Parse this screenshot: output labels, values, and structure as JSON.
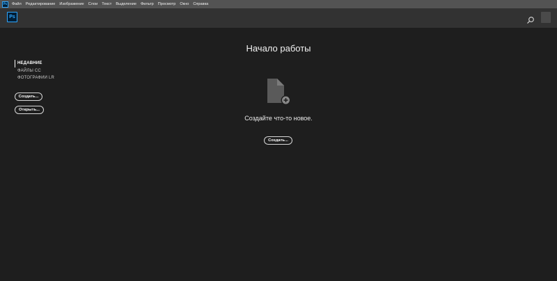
{
  "menubar": {
    "app_icon": "Ps",
    "items": [
      "Файл",
      "Редактирование",
      "Изображение",
      "Слои",
      "Текст",
      "Выделение",
      "Фильтр",
      "Просмотр",
      "Окно",
      "Справка"
    ]
  },
  "topbar": {
    "logo": "Ps",
    "search_icon": "search-icon",
    "account_icon": "account-avatar"
  },
  "sidebar": {
    "items": [
      {
        "label": "НЕДАВНИЕ",
        "active": true
      },
      {
        "label": "ФАЙЛЫ CC",
        "active": false
      },
      {
        "label": "ФОТОГРАФИИ LR",
        "active": false
      }
    ],
    "create_label": "Создать...",
    "open_label": "Открыть..."
  },
  "main": {
    "title": "Начало работы",
    "empty_icon": "new-document-icon",
    "empty_message": "Создайте что-то новое.",
    "create_label": "Создать..."
  },
  "colors": {
    "background": "#1e1e1e",
    "menubar": "#535353",
    "topbar": "#323232",
    "ps_accent": "#31a8ff",
    "ps_bg": "#001e36"
  }
}
